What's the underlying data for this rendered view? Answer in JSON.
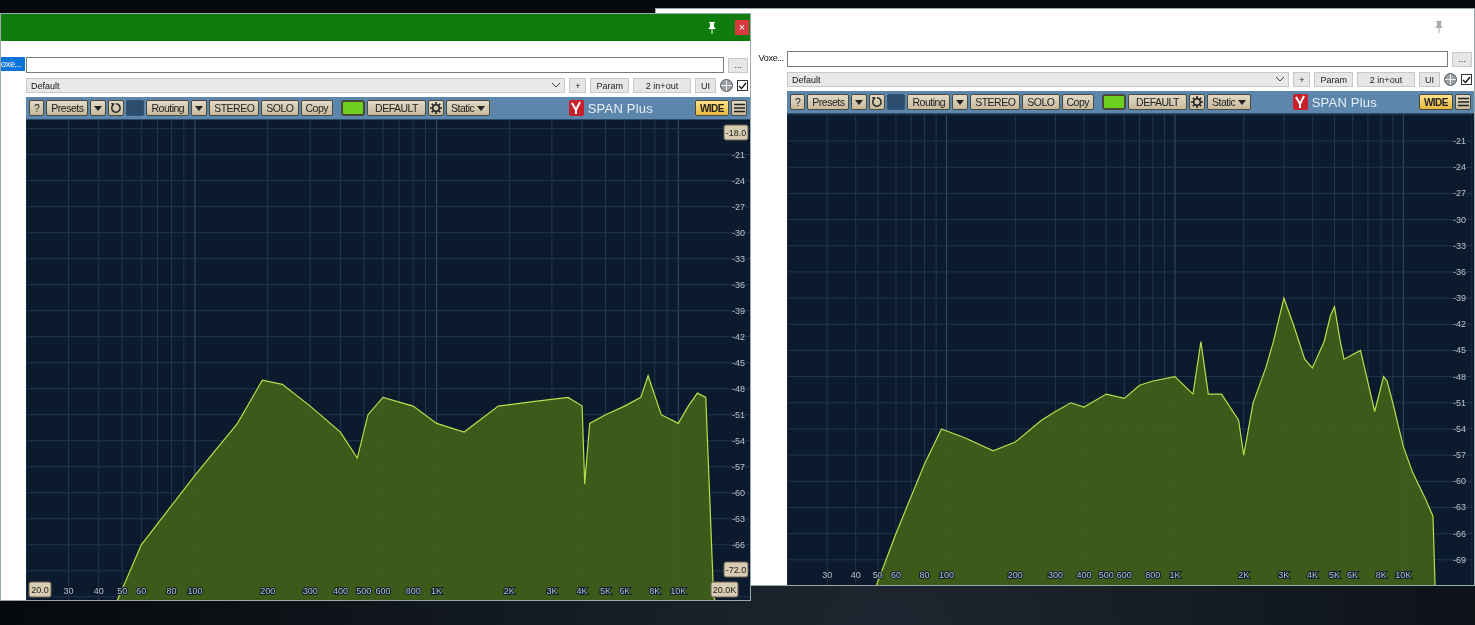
{
  "windows": [
    {
      "active": false,
      "sidebar_item": {
        "label": "Voxe...",
        "selected": false
      },
      "field_button": "...",
      "host": {
        "program": "Default",
        "add": "+",
        "param": "Param",
        "io": "2 in+out",
        "ui": "UI",
        "enabled": true
      },
      "toolbar": {
        "help": "?",
        "presets": "Presets",
        "routing": "Routing",
        "stereo": "STEREO",
        "solo": "SOLO",
        "copy": "Copy",
        "led_on": true,
        "default": "DEFAULT",
        "mode": "Static",
        "logo": "SPAN Plus",
        "wide": "WIDE",
        "wide_on": true
      },
      "y_labels": [
        {
          "text": "-21",
          "kind": "tick"
        },
        {
          "text": "-24",
          "kind": "tick"
        },
        {
          "text": "-27",
          "kind": "tick"
        },
        {
          "text": "-30",
          "kind": "tick"
        },
        {
          "text": "-33",
          "kind": "tick"
        },
        {
          "text": "-36",
          "kind": "tick"
        },
        {
          "text": "-39",
          "kind": "tick"
        },
        {
          "text": "-42",
          "kind": "tick"
        },
        {
          "text": "-45",
          "kind": "tick"
        },
        {
          "text": "-48",
          "kind": "tick"
        },
        {
          "text": "-51",
          "kind": "tick"
        },
        {
          "text": "-54",
          "kind": "tick"
        },
        {
          "text": "-57",
          "kind": "tick"
        },
        {
          "text": "-60",
          "kind": "tick"
        },
        {
          "text": "-63",
          "kind": "tick"
        },
        {
          "text": "-66",
          "kind": "tick"
        },
        {
          "text": "-69",
          "kind": "tick"
        }
      ],
      "x_labels": [
        {
          "text": "30",
          "kind": "tick"
        },
        {
          "text": "40",
          "kind": "tick"
        },
        {
          "text": "50",
          "kind": "tick"
        },
        {
          "text": "60",
          "kind": "tick"
        },
        {
          "text": "80",
          "kind": "tick"
        },
        {
          "text": "100",
          "kind": "tick"
        },
        {
          "text": "200",
          "kind": "tick"
        },
        {
          "text": "300",
          "kind": "tick"
        },
        {
          "text": "400",
          "kind": "tick"
        },
        {
          "text": "500",
          "kind": "tick"
        },
        {
          "text": "600",
          "kind": "tick"
        },
        {
          "text": "800",
          "kind": "tick"
        },
        {
          "text": "1K",
          "kind": "tick"
        },
        {
          "text": "2K",
          "kind": "tick"
        },
        {
          "text": "3K",
          "kind": "tick"
        },
        {
          "text": "4K",
          "kind": "tick"
        },
        {
          "text": "5K",
          "kind": "tick"
        },
        {
          "text": "6K",
          "kind": "tick"
        },
        {
          "text": "8K",
          "kind": "tick"
        },
        {
          "text": "10K",
          "kind": "tick"
        }
      ]
    },
    {
      "active": true,
      "close": "×",
      "sidebar_item": {
        "label": "oxe...",
        "selected": true
      },
      "field_button": "...",
      "host": {
        "program": "Default",
        "add": "+",
        "param": "Param",
        "io": "2 in+out",
        "ui": "UI",
        "enabled": true
      },
      "toolbar": {
        "help": "?",
        "presets": "Presets",
        "routing": "Routing",
        "stereo": "STEREO",
        "solo": "SOLO",
        "copy": "Copy",
        "led_on": true,
        "default": "DEFAULT",
        "mode": "Static",
        "logo": "SPAN Plus",
        "wide": "WIDE",
        "wide_on": true
      },
      "y_labels": [
        {
          "text": "-18.0",
          "kind": "box"
        },
        {
          "text": "-21",
          "kind": "tick"
        },
        {
          "text": "-24",
          "kind": "tick"
        },
        {
          "text": "-27",
          "kind": "tick"
        },
        {
          "text": "-30",
          "kind": "tick"
        },
        {
          "text": "-33",
          "kind": "tick"
        },
        {
          "text": "-36",
          "kind": "tick"
        },
        {
          "text": "-39",
          "kind": "tick"
        },
        {
          "text": "-42",
          "kind": "tick"
        },
        {
          "text": "-45",
          "kind": "tick"
        },
        {
          "text": "-48",
          "kind": "tick"
        },
        {
          "text": "-51",
          "kind": "tick"
        },
        {
          "text": "-54",
          "kind": "tick"
        },
        {
          "text": "-57",
          "kind": "tick"
        },
        {
          "text": "-60",
          "kind": "tick"
        },
        {
          "text": "-63",
          "kind": "tick"
        },
        {
          "text": "-66",
          "kind": "tick"
        },
        {
          "text": "-72.0",
          "kind": "box"
        }
      ],
      "x_labels": [
        {
          "text": "20.0",
          "kind": "box"
        },
        {
          "text": "30",
          "kind": "tick"
        },
        {
          "text": "40",
          "kind": "tick"
        },
        {
          "text": "50",
          "kind": "tick"
        },
        {
          "text": "60",
          "kind": "tick"
        },
        {
          "text": "80",
          "kind": "tick"
        },
        {
          "text": "100",
          "kind": "tick"
        },
        {
          "text": "200",
          "kind": "tick"
        },
        {
          "text": "300",
          "kind": "tick"
        },
        {
          "text": "400",
          "kind": "tick"
        },
        {
          "text": "500",
          "kind": "tick"
        },
        {
          "text": "600",
          "kind": "tick"
        },
        {
          "text": "800",
          "kind": "tick"
        },
        {
          "text": "1K",
          "kind": "tick"
        },
        {
          "text": "2K",
          "kind": "tick"
        },
        {
          "text": "3K",
          "kind": "tick"
        },
        {
          "text": "4K",
          "kind": "tick"
        },
        {
          "text": "5K",
          "kind": "tick"
        },
        {
          "text": "6K",
          "kind": "tick"
        },
        {
          "text": "8K",
          "kind": "tick"
        },
        {
          "text": "10K",
          "kind": "tick"
        },
        {
          "text": "20.0K",
          "kind": "box"
        }
      ]
    }
  ]
}
